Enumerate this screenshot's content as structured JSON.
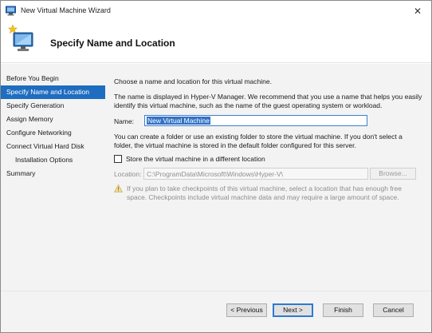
{
  "window": {
    "title": "New Virtual Machine Wizard"
  },
  "header": {
    "title": "Specify Name and Location"
  },
  "nav": {
    "items": [
      {
        "label": "Before You Begin"
      },
      {
        "label": "Specify Name and Location"
      },
      {
        "label": "Specify Generation"
      },
      {
        "label": "Assign Memory"
      },
      {
        "label": "Configure Networking"
      },
      {
        "label": "Connect Virtual Hard Disk"
      },
      {
        "label": "Installation Options"
      },
      {
        "label": "Summary"
      }
    ],
    "selected_index": 1
  },
  "main": {
    "intro": "Choose a name and location for this virtual machine.",
    "desc_line1": "The name is displayed in Hyper-V Manager. We recommend that you use a name that helps you easily",
    "desc_line2": "identify this virtual machine, such as the name of the guest operating system or workload.",
    "name_label": "Name:",
    "name_value": "New Virtual Machine",
    "folder_line1": "You can create a folder or use an existing folder to store the virtual machine. If you don't select a",
    "folder_line2": "folder, the virtual machine is stored in the default folder configured for this server.",
    "checkbox_label": "Store the virtual machine in a different location",
    "checkbox_checked": false,
    "location_label": "Location:",
    "location_value": "C:\\ProgramData\\Microsoft\\Windows\\Hyper-V\\",
    "browse_label": "Browse...",
    "warning_line1": "If you plan to take checkpoints of this virtual machine, select a location that has enough free",
    "warning_line2": "space. Checkpoints include virtual machine data and may require a large amount of space."
  },
  "footer": {
    "previous_label": "< Previous",
    "next_label": "Next >",
    "finish_label": "Finish",
    "cancel_label": "Cancel"
  },
  "colors": {
    "selection": "#1f6dc0",
    "panel_bg": "#f3f3f3",
    "disabled_text": "#8e8e8e"
  }
}
